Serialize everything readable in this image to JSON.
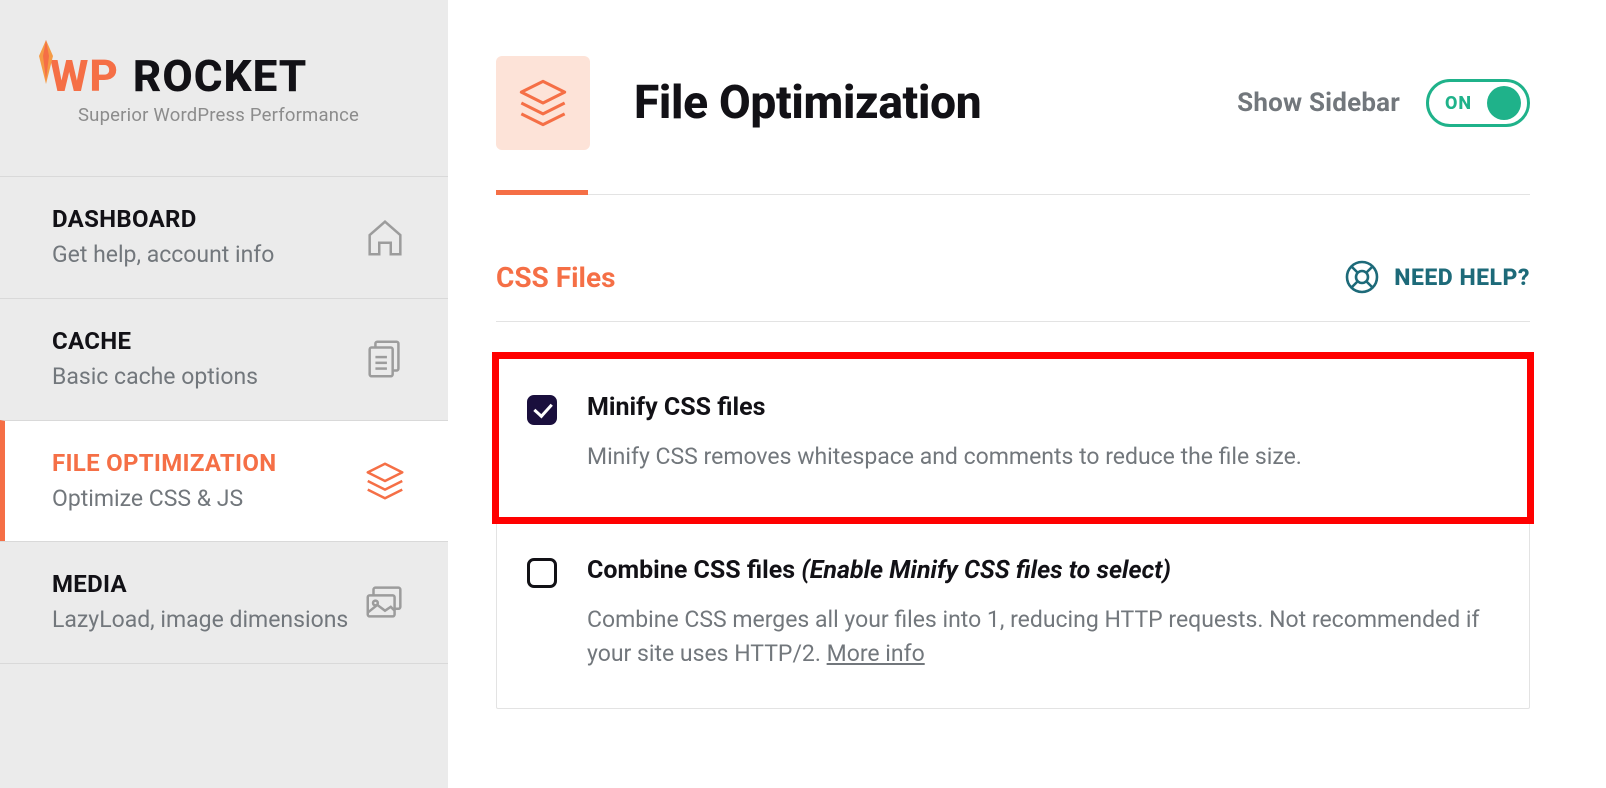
{
  "brand": {
    "wp": "WP",
    "rocket": "ROCKET",
    "tagline": "Superior WordPress Performance"
  },
  "sidebar": {
    "items": [
      {
        "title": "DASHBOARD",
        "sub": "Get help, account info"
      },
      {
        "title": "CACHE",
        "sub": "Basic cache options"
      },
      {
        "title": "FILE OPTIMIZATION",
        "sub": "Optimize CSS & JS"
      },
      {
        "title": "MEDIA",
        "sub": "LazyLoad, image dimensions"
      }
    ]
  },
  "header": {
    "title": "File Optimization",
    "show_sidebar_label": "Show Sidebar",
    "toggle_state": "ON"
  },
  "section": {
    "title": "CSS Files",
    "help_label": "NEED HELP?"
  },
  "options": {
    "minify": {
      "title": "Minify CSS files",
      "desc": "Minify CSS removes whitespace and comments to reduce the file size.",
      "checked": true
    },
    "combine": {
      "title": "Combine CSS files ",
      "hint": "(Enable Minify CSS files to select)",
      "desc": "Combine CSS merges all your files into 1, reducing HTTP requests. Not recommended if your site uses HTTP/2. ",
      "more": "More info",
      "checked": false
    }
  }
}
